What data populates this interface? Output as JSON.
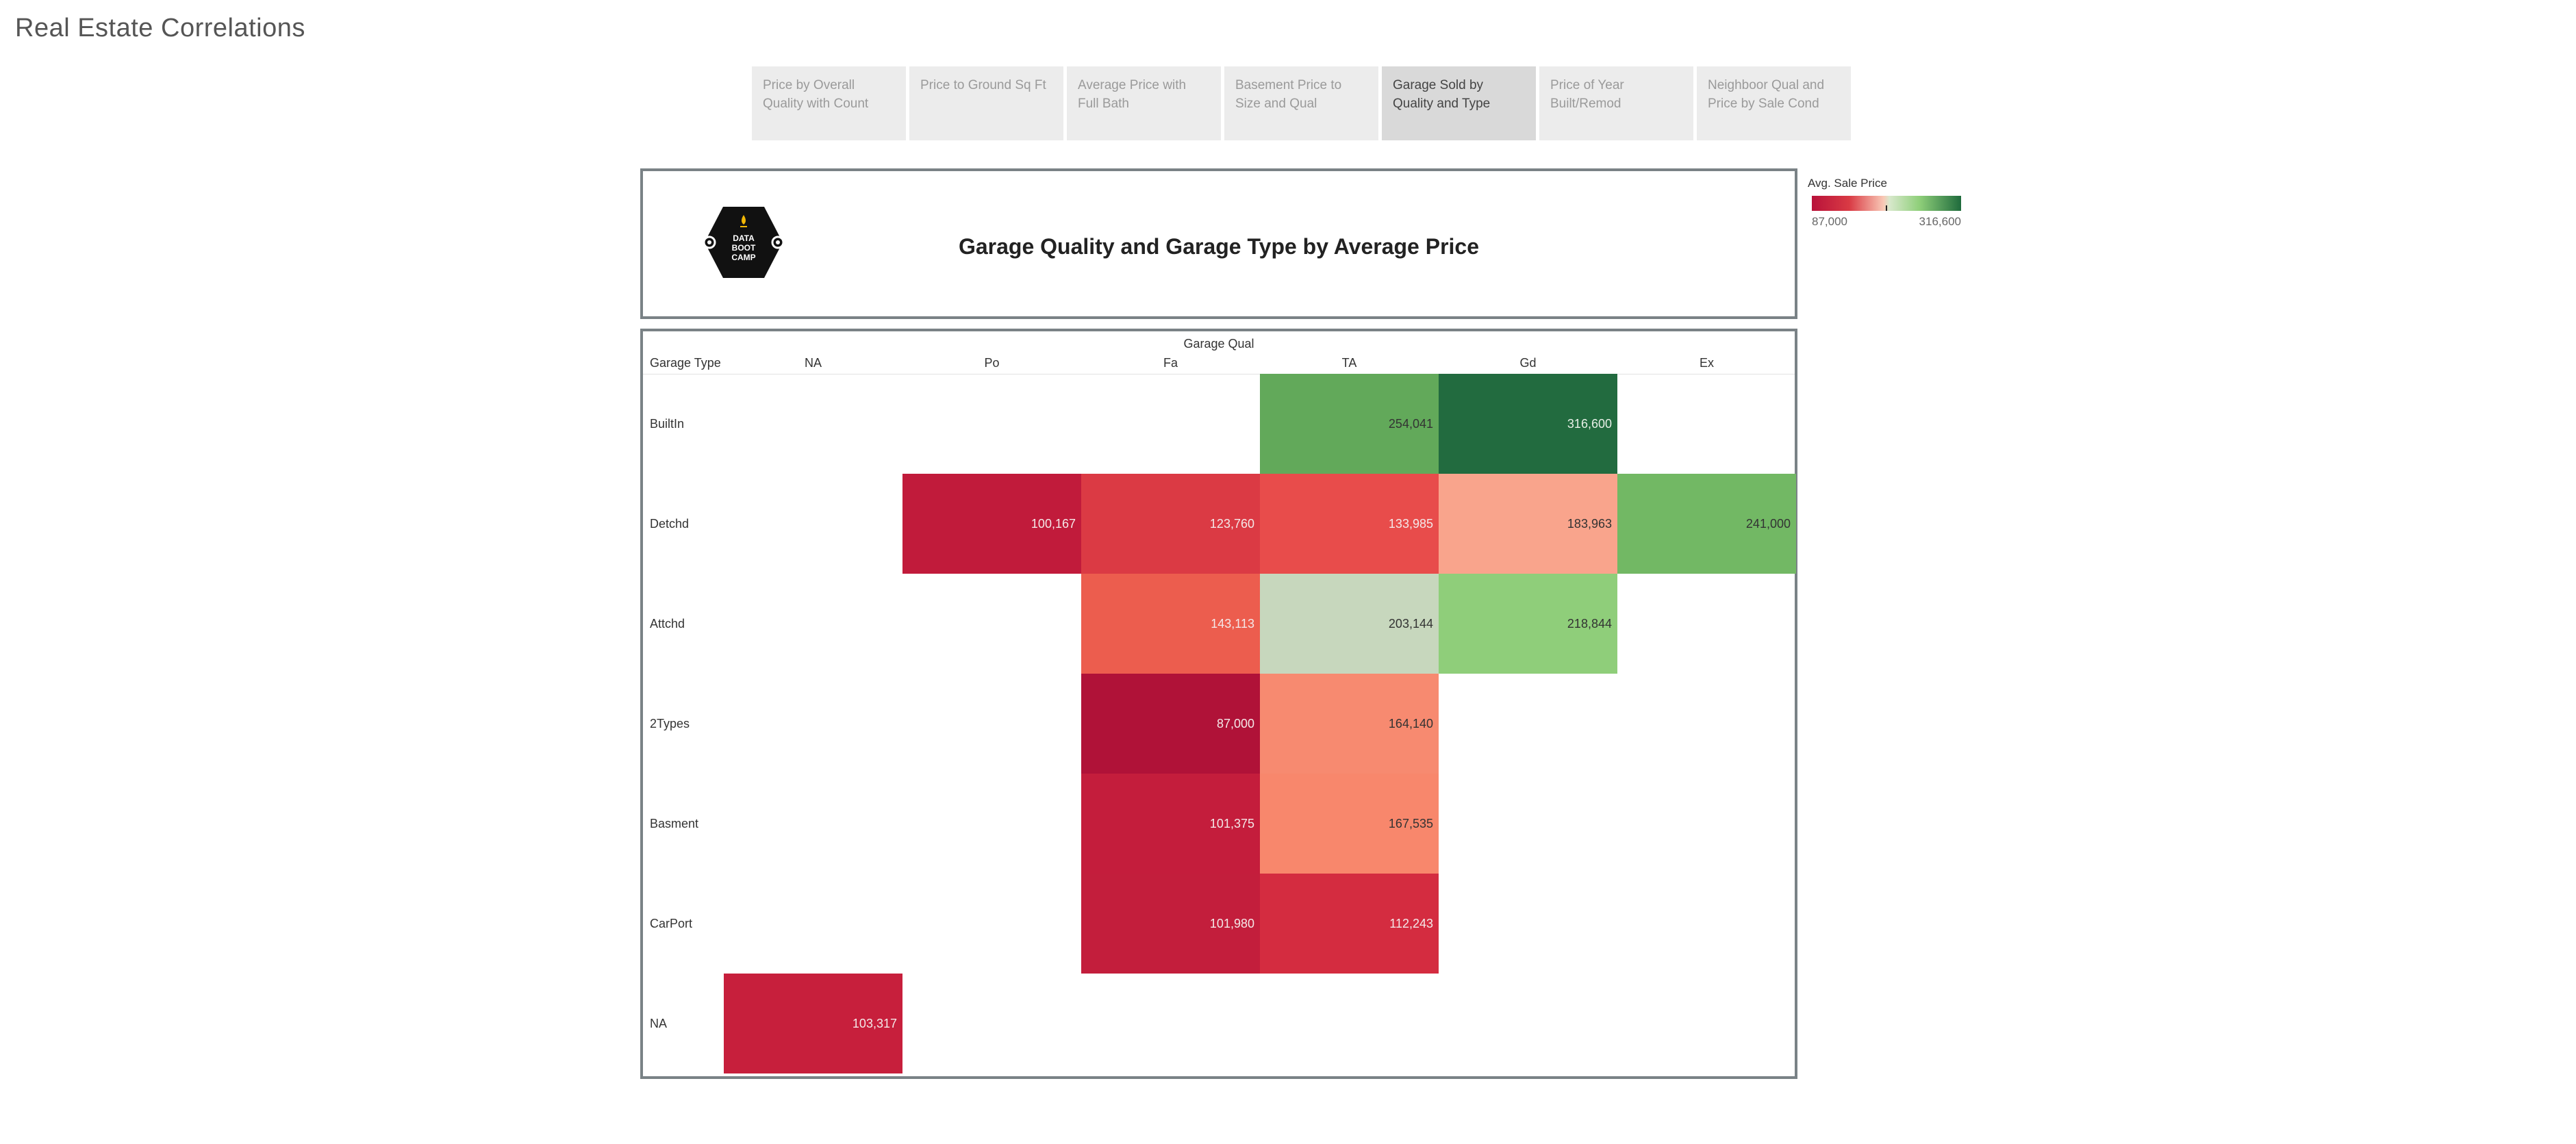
{
  "app": {
    "title": "Real Estate Correlations"
  },
  "tabs": [
    {
      "label": "Price by Overall Quality with Count",
      "active": false
    },
    {
      "label": "Price to Ground Sq Ft",
      "active": false
    },
    {
      "label": "Average Price with Full Bath",
      "active": false
    },
    {
      "label": "Basement Price to Size and Qual",
      "active": false
    },
    {
      "label": "Garage Sold by Quality and Type",
      "active": true
    },
    {
      "label": "Price of Year Built/Remod",
      "active": false
    },
    {
      "label": "Neighboor Qual and Price by Sale Cond",
      "active": false
    }
  ],
  "header": {
    "logo_text": [
      "DATA",
      "BOOT",
      "CAMP"
    ],
    "title": "Garage Quality and Garage Type by Average Price"
  },
  "legend": {
    "title": "Avg. Sale Price",
    "min_label": "87,000",
    "max_label": "316,600",
    "colors": {
      "low": "#b8123a",
      "mid": "#f9c8b6",
      "high": "#1f6b3c"
    }
  },
  "chart_data": {
    "type": "heatmap",
    "title": "Garage Quality and Garage Type by Average Price",
    "column_group_label": "Garage Qual",
    "row_header_label": "Garage Type",
    "columns": [
      "NA",
      "Po",
      "Fa",
      "TA",
      "Gd",
      "Ex"
    ],
    "rows": [
      "BuiltIn",
      "Detchd",
      "Attchd",
      "2Types",
      "Basment",
      "CarPort",
      "NA"
    ],
    "values": [
      [
        null,
        null,
        null,
        254041,
        316600,
        null
      ],
      [
        null,
        100167,
        123760,
        133985,
        183963,
        241000
      ],
      [
        null,
        null,
        143113,
        203144,
        218844,
        null
      ],
      [
        null,
        null,
        87000,
        164140,
        null,
        null
      ],
      [
        null,
        null,
        101375,
        167535,
        null,
        null
      ],
      [
        null,
        null,
        101980,
        112243,
        null,
        null
      ],
      [
        103317,
        null,
        null,
        null,
        null,
        null
      ]
    ],
    "value_labels": [
      [
        null,
        null,
        null,
        "254,041",
        "316,600",
        null
      ],
      [
        null,
        "100,167",
        "123,760",
        "133,985",
        "183,963",
        "241,000"
      ],
      [
        null,
        null,
        "143,113",
        "203,144",
        "218,844",
        null
      ],
      [
        null,
        null,
        "87,000",
        "164,140",
        null,
        null
      ],
      [
        null,
        null,
        "101,375",
        "167,535",
        null,
        null
      ],
      [
        null,
        null,
        "101,980",
        "112,243",
        null,
        null
      ],
      [
        "103,317",
        null,
        null,
        null,
        null,
        null
      ]
    ],
    "cell_colors": [
      [
        null,
        null,
        null,
        "#62a95a",
        "#226b3f",
        null
      ],
      [
        null,
        "#c11b3b",
        "#db3a44",
        "#e84c4b",
        "#f9a48c",
        "#72b864"
      ],
      [
        null,
        null,
        "#ec5d4e",
        "#c7d7bd",
        "#8fce7a",
        null
      ],
      [
        null,
        null,
        "#b01238",
        "#f78a70",
        null,
        null
      ],
      [
        null,
        null,
        "#c41d3c",
        "#f8876c",
        null,
        null
      ],
      [
        null,
        null,
        "#c31e3c",
        "#d42c40",
        null,
        null
      ],
      [
        "#c71f3c",
        null,
        null,
        null,
        null,
        null
      ]
    ],
    "color_range": [
      87000,
      316600
    ]
  }
}
